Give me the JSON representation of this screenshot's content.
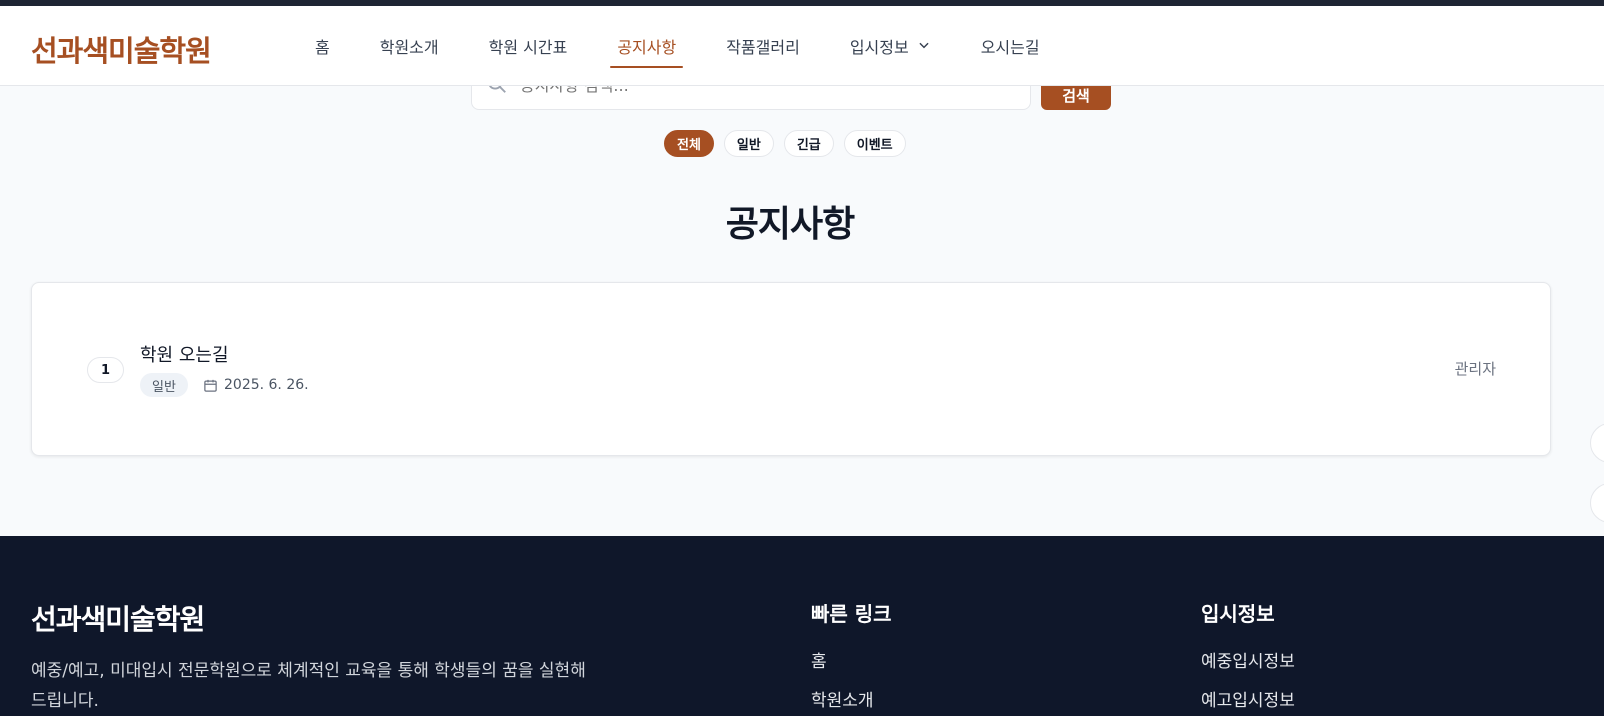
{
  "header": {
    "brand": "선과색미술학원",
    "nav": [
      {
        "label": "홈"
      },
      {
        "label": "학원소개"
      },
      {
        "label": "학원 시간표"
      },
      {
        "label": "공지사항"
      },
      {
        "label": "작품갤러리"
      },
      {
        "label": "입시정보"
      },
      {
        "label": "오시는길"
      }
    ],
    "active_index": 3
  },
  "search": {
    "placeholder": "공지사항 검색...",
    "button_label": "검색"
  },
  "filters": [
    "전체",
    "일반",
    "긴급",
    "이벤트"
  ],
  "page_title": "공지사항",
  "notices": [
    {
      "number": "1",
      "title": "학원 오는길",
      "category": "일반",
      "date": "2025. 6. 26.",
      "author": "관리자"
    }
  ],
  "footer": {
    "brand": "선과색미술학원",
    "description": "예중/예고, 미대입시 전문학원으로 체계적인 교육을 통해 학생들의 꿈을 실현해드립니다.",
    "quick_links": {
      "heading": "빠른 링크",
      "items": [
        "홈",
        "학원소개"
      ]
    },
    "admission": {
      "heading": "입시정보",
      "items": [
        "예중입시정보",
        "예고입시정보"
      ]
    }
  },
  "colors": {
    "accent": "#a64f22",
    "footer_bg": "#0f172a"
  }
}
